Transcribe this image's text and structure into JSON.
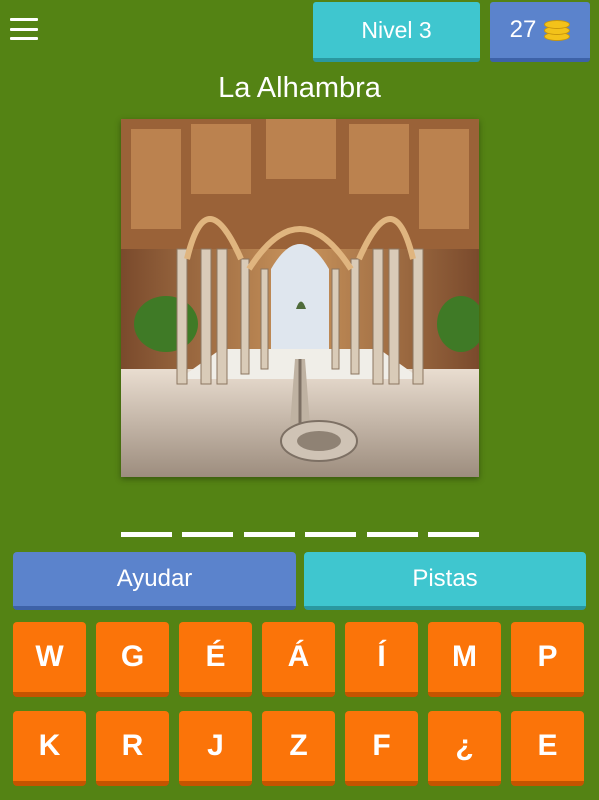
{
  "header": {
    "menu_icon": "hamburger-menu-icon",
    "level_label": "Nivel 3",
    "coins": "27",
    "coin_icon": "coin-stack-icon"
  },
  "puzzle": {
    "title": "La Alhambra",
    "image_alt": "Patio de los Leones, La Alhambra",
    "answer_slot_count": 6
  },
  "actions": {
    "help_label": "Ayudar",
    "hints_label": "Pistas"
  },
  "keyboard": {
    "row1": [
      "W",
      "G",
      "É",
      "Á",
      "Í",
      "M",
      "P"
    ],
    "row2": [
      "K",
      "R",
      "J",
      "Z",
      "F",
      "¿",
      "E"
    ]
  },
  "colors": {
    "background": "#548314",
    "level_button": "#3fc6cf",
    "coins_button": "#5b83cc",
    "key": "#fb7409"
  }
}
